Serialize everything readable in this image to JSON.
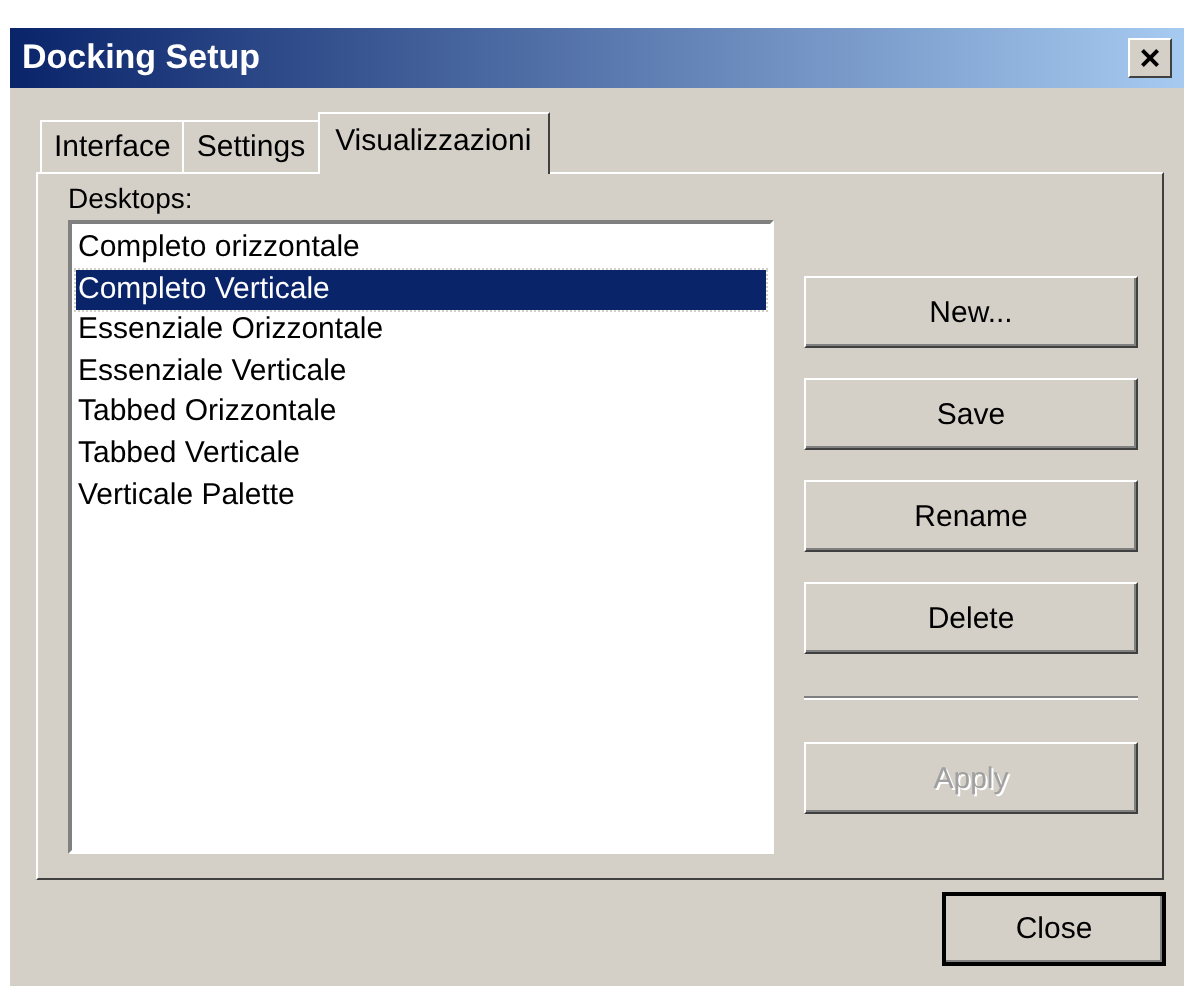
{
  "window": {
    "title": "Docking Setup",
    "close_glyph": "×"
  },
  "tabs": [
    {
      "label": "Interface",
      "selected": false
    },
    {
      "label": "Settings",
      "selected": false
    },
    {
      "label": "Visualizzazioni",
      "selected": true
    }
  ],
  "desktops": {
    "label": "Desktops:",
    "items": [
      {
        "label": "Completo orizzontale",
        "selected": false
      },
      {
        "label": "Completo Verticale",
        "selected": true
      },
      {
        "label": "Essenziale Orizzontale",
        "selected": false
      },
      {
        "label": "Essenziale Verticale",
        "selected": false
      },
      {
        "label": "Tabbed Orizzontale",
        "selected": false
      },
      {
        "label": "Tabbed Verticale",
        "selected": false
      },
      {
        "label": "Verticale Palette",
        "selected": false
      }
    ]
  },
  "buttons": [
    {
      "label": "New...",
      "disabled": false
    },
    {
      "label": "Save",
      "disabled": false
    },
    {
      "label": "Rename",
      "disabled": false
    },
    {
      "label": "Delete",
      "disabled": false
    },
    {
      "label": "Apply",
      "disabled": true,
      "separator_before": true
    }
  ],
  "close_button": "Close"
}
